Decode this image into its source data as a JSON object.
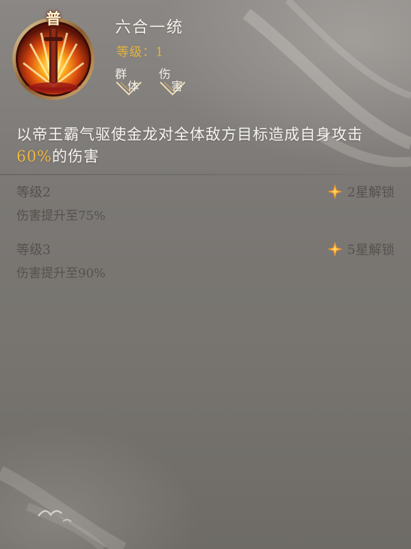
{
  "skill": {
    "quality_badge": "普",
    "name": "六合一统",
    "level": "等级：1",
    "tags": [
      {
        "chars": [
          "群",
          "体"
        ]
      },
      {
        "chars": [
          "伤",
          "害"
        ]
      }
    ],
    "description_prefix": "以帝王霸气驱使金龙对全体敌方目标造成自身攻击",
    "description_value": "60%",
    "description_suffix": "的伤害",
    "icon": "flaming-sword-icon"
  },
  "upgrades": [
    {
      "level": "等级2",
      "effect": "伤害提升至75%",
      "unlock": "2星解锁",
      "icon": "star-spark-icon"
    },
    {
      "level": "等级3",
      "effect": "伤害提升至90%",
      "unlock": "5星解锁",
      "icon": "star-spark-icon"
    }
  ],
  "colors": {
    "accent_gold": "#e3b23c",
    "highlight_orange": "#f0b640",
    "locked_text": "#55524e",
    "title_text": "#f4f1ea"
  }
}
